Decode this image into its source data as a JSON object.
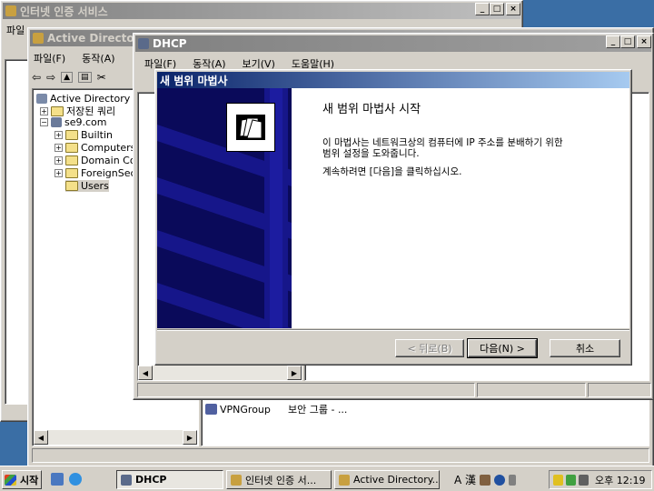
{
  "ie_window": {
    "title": "인터넷 인증 서비스",
    "menu_first": "파일"
  },
  "ad_window": {
    "title": "Active Directory",
    "menu": [
      "파일(F)",
      "동작(A)"
    ],
    "tree": [
      "Active Directory 사",
      "저장된 쿼리",
      "se9.com",
      "Builtin",
      "Computers",
      "Domain Co",
      "ForeignSec",
      "Users"
    ],
    "list_row": {
      "name": "VPNGroup",
      "type": "보안 그룹 - ..."
    }
  },
  "dhcp_window": {
    "title": "DHCP",
    "menu": [
      "파일(F)",
      "동작(A)",
      "보기(V)",
      "도움말(H)"
    ]
  },
  "wizard": {
    "title": "새 범위 마법사",
    "heading": "새 범위 마법사 시작",
    "body_line1": "이 마법사는 네트워크상의 컴퓨터에 IP 주소를 분배하기 위한",
    "body_line2": "범위 설정을 도와줍니다.",
    "continue_text": "계속하려면 [다음]을 클릭하십시오.",
    "back_button": "< 뒤로(B)",
    "next_button": "다음(N) >",
    "cancel_button": "취소"
  },
  "taskbar": {
    "start": "시작",
    "tasks": [
      "DHCP",
      "인터넷 인증 서...",
      "Active Directory..."
    ],
    "tray_lang": "A 漢",
    "clock": "오후 12:19"
  },
  "colors": {
    "titlebar_active": "#0a246a",
    "wizard_side": "#0a0a5a",
    "desktop": "#3a6ea5"
  }
}
